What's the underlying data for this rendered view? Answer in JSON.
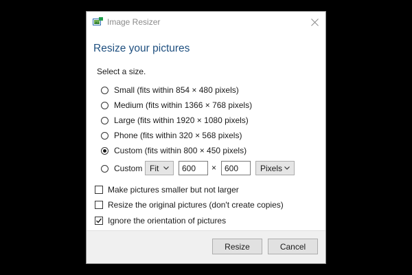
{
  "window": {
    "title": "Image Resizer",
    "icon": "image-resizer-app-icon",
    "close_icon": "close-icon"
  },
  "heading": "Resize your pictures",
  "select_label": "Select a size.",
  "size_options": [
    {
      "label": "Small (fits within 854 × 480 pixels)",
      "selected": false
    },
    {
      "label": "Medium (fits within 1366 × 768 pixels)",
      "selected": false
    },
    {
      "label": "Large (fits within 1920 × 1080 pixels)",
      "selected": false
    },
    {
      "label": "Phone (fits within 320 × 568 pixels)",
      "selected": false
    },
    {
      "label": "Custom (fits within 800 × 450 pixels)",
      "selected": true
    }
  ],
  "custom_row": {
    "label": "Custom",
    "selected": false,
    "fit_mode": "Fit",
    "width": "600",
    "times": "×",
    "height": "600",
    "unit": "Pixels"
  },
  "options": [
    {
      "label": "Make pictures smaller but not larger",
      "checked": false
    },
    {
      "label": "Resize the original pictures (don't create copies)",
      "checked": false
    },
    {
      "label": "Ignore the orientation of pictures",
      "checked": true
    }
  ],
  "buttons": {
    "resize": "Resize",
    "cancel": "Cancel"
  },
  "colors": {
    "heading": "#1e4f7f",
    "footer_bg": "#f0f0f0",
    "button_bg": "#e1e1e1",
    "backdrop": "#000000"
  }
}
